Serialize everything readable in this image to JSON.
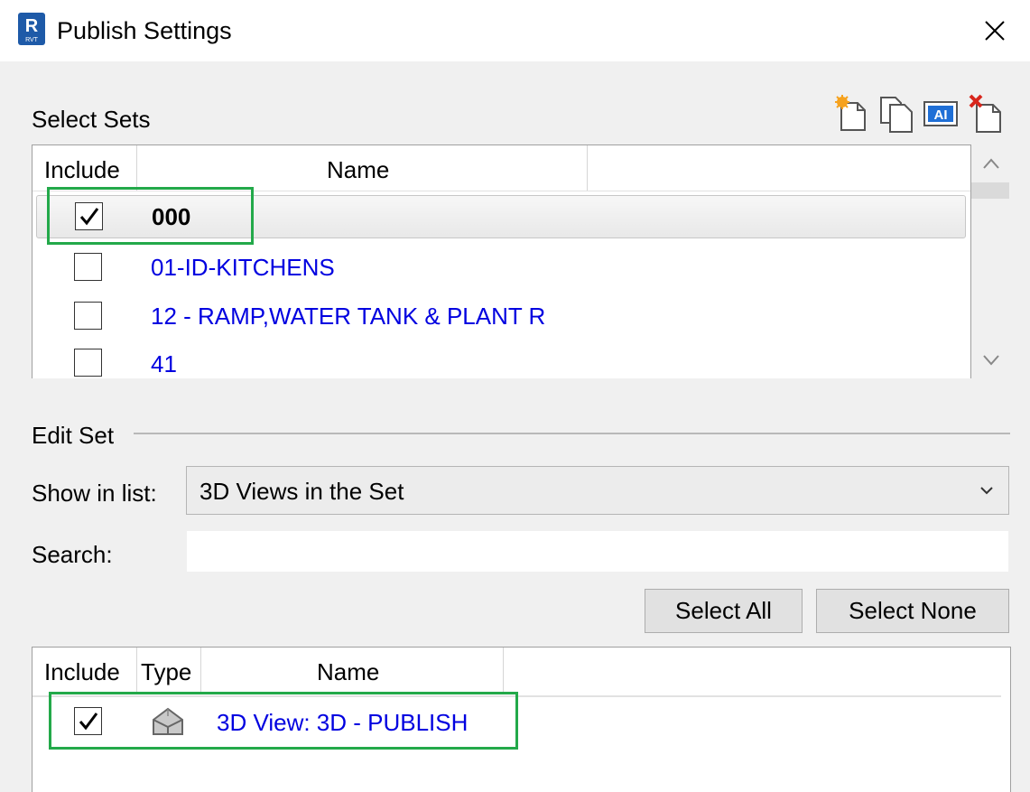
{
  "window": {
    "title": "Publish Settings",
    "app_icon_letter": "R",
    "app_icon_sub": "RVT",
    "close_icon": "close-icon"
  },
  "select_sets": {
    "label": "Select Sets",
    "toolbar": [
      "new-set-icon",
      "duplicate-set-icon",
      "rename-set-icon",
      "delete-set-icon"
    ],
    "columns": {
      "include": "Include",
      "name": "Name"
    },
    "rows": [
      {
        "checked": true,
        "name": "000",
        "selected": true
      },
      {
        "checked": false,
        "name": "01-ID-KITCHENS",
        "selected": false
      },
      {
        "checked": false,
        "name": "12 - RAMP,WATER TANK & PLANT R",
        "selected": false
      },
      {
        "checked": false,
        "name": "41",
        "selected": false
      }
    ]
  },
  "edit_set": {
    "label": "Edit Set",
    "show_in_list_label": "Show in list:",
    "show_in_list_value": "3D Views in the Set",
    "search_label": "Search:",
    "search_value": "",
    "select_all": "Select All",
    "select_none": "Select None",
    "columns": {
      "include": "Include",
      "type": "Type",
      "name": "Name"
    },
    "rows": [
      {
        "checked": true,
        "type_icon": "3d-view-icon",
        "name": "3D View: 3D - PUBLISH"
      }
    ]
  },
  "colors": {
    "link_blue": "#0000e0",
    "highlight_green": "#23a94a",
    "revit_blue": "#1e5aa8"
  }
}
